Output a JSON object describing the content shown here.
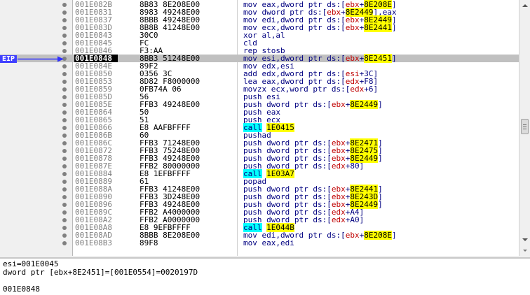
{
  "eip_label": "EIP",
  "rows": [
    {
      "addr": "001E082B",
      "hex": "8B83 8E208E00",
      "ins": [
        {
          "t": "mov eax,dword ptr ds:["
        },
        {
          "t": "ebx",
          "c": "red"
        },
        {
          "t": "+"
        },
        {
          "t": "8E208E",
          "h": "Y"
        },
        {
          "t": "]"
        }
      ]
    },
    {
      "addr": "001E0831",
      "hex": "8983 49248E00",
      "ins": [
        {
          "t": "mov dword ptr ds:["
        },
        {
          "t": "ebx",
          "c": "red"
        },
        {
          "t": "+"
        },
        {
          "t": "8E2449",
          "h": "Y"
        },
        {
          "t": "],eax"
        }
      ]
    },
    {
      "addr": "001E0837",
      "hex": "8BBB 49248E00",
      "ins": [
        {
          "t": "mov edi,dword ptr ds:["
        },
        {
          "t": "ebx",
          "c": "red"
        },
        {
          "t": "+"
        },
        {
          "t": "8E2449",
          "h": "Y"
        },
        {
          "t": "]"
        }
      ]
    },
    {
      "addr": "001E083D",
      "hex": "8B8B 41248E00",
      "ins": [
        {
          "t": "mov ecx,dword ptr ds:["
        },
        {
          "t": "ebx",
          "c": "red"
        },
        {
          "t": "+"
        },
        {
          "t": "8E2441",
          "h": "Y"
        },
        {
          "t": "]"
        }
      ]
    },
    {
      "addr": "001E0843",
      "hex": "30C0",
      "ins": [
        {
          "t": "xor al,al"
        }
      ]
    },
    {
      "addr": "001E0845",
      "hex": "FC",
      "ins": [
        {
          "t": "cld"
        }
      ]
    },
    {
      "addr": "001E0846",
      "hex": "F3:AA",
      "ins": [
        {
          "t": "rep stosb"
        }
      ]
    },
    {
      "addr": "001E0848",
      "hex": "8BB3 51248E00",
      "cur": true,
      "ins": [
        {
          "t": "mov esi,dword ptr ds:["
        },
        {
          "t": "ebx",
          "c": "red"
        },
        {
          "t": "+"
        },
        {
          "t": "8E2451",
          "h": "Y"
        },
        {
          "t": "]"
        }
      ]
    },
    {
      "addr": "001E084E",
      "hex": "89F2",
      "ins": [
        {
          "t": "mov edx,esi"
        }
      ]
    },
    {
      "addr": "001E0850",
      "hex": "0356 3C",
      "ins": [
        {
          "t": "add edx,dword ptr ds:["
        },
        {
          "t": "esi",
          "c": "red"
        },
        {
          "t": "+3C]"
        }
      ]
    },
    {
      "addr": "001E0853",
      "hex": "8D82 F8000000",
      "ins": [
        {
          "t": "lea eax,dword ptr ds:["
        },
        {
          "t": "edx",
          "c": "red"
        },
        {
          "t": "+F8]"
        }
      ]
    },
    {
      "addr": "001E0859",
      "hex": "0FB74A 06",
      "ins": [
        {
          "t": "movzx ecx,word ptr ds:["
        },
        {
          "t": "edx",
          "c": "red"
        },
        {
          "t": "+6]"
        }
      ]
    },
    {
      "addr": "001E085D",
      "hex": "56",
      "ins": [
        {
          "t": "push esi"
        }
      ]
    },
    {
      "addr": "001E085E",
      "hex": "FFB3 49248E00",
      "ins": [
        {
          "t": "push dword ptr ds:["
        },
        {
          "t": "ebx",
          "c": "red"
        },
        {
          "t": "+"
        },
        {
          "t": "8E2449",
          "h": "Y"
        },
        {
          "t": "]"
        }
      ]
    },
    {
      "addr": "001E0864",
      "hex": "50",
      "ins": [
        {
          "t": "push eax"
        }
      ]
    },
    {
      "addr": "001E0865",
      "hex": "51",
      "ins": [
        {
          "t": "push ecx"
        }
      ]
    },
    {
      "addr": "001E0866",
      "hex": "E8 AAFBFFFF",
      "ins": [
        {
          "t": "call",
          "h": "C"
        },
        {
          "t": " "
        },
        {
          "t": "1E0415",
          "h": "Y"
        }
      ]
    },
    {
      "addr": "001E086B",
      "hex": "60",
      "ins": [
        {
          "t": "pushad"
        }
      ]
    },
    {
      "addr": "001E086C",
      "hex": "FFB3 71248E00",
      "ins": [
        {
          "t": "push dword ptr ds:["
        },
        {
          "t": "ebx",
          "c": "red"
        },
        {
          "t": "+"
        },
        {
          "t": "8E2471",
          "h": "Y"
        },
        {
          "t": "]"
        }
      ]
    },
    {
      "addr": "001E0872",
      "hex": "FFB3 75248E00",
      "ins": [
        {
          "t": "push dword ptr ds:["
        },
        {
          "t": "ebx",
          "c": "red"
        },
        {
          "t": "+"
        },
        {
          "t": "8E2475",
          "h": "Y"
        },
        {
          "t": "]"
        }
      ]
    },
    {
      "addr": "001E0878",
      "hex": "FFB3 49248E00",
      "ins": [
        {
          "t": "push dword ptr ds:["
        },
        {
          "t": "ebx",
          "c": "red"
        },
        {
          "t": "+"
        },
        {
          "t": "8E2449",
          "h": "Y"
        },
        {
          "t": "]"
        }
      ]
    },
    {
      "addr": "001E087E",
      "hex": "FFB2 80000000",
      "ins": [
        {
          "t": "push dword ptr ds:["
        },
        {
          "t": "edx",
          "c": "red"
        },
        {
          "t": "+80]"
        }
      ]
    },
    {
      "addr": "001E0884",
      "hex": "E8 1EFBFFFF",
      "ins": [
        {
          "t": "call",
          "h": "C"
        },
        {
          "t": " "
        },
        {
          "t": "1E03A7",
          "h": "Y"
        }
      ]
    },
    {
      "addr": "001E0889",
      "hex": "61",
      "ins": [
        {
          "t": "popad"
        }
      ]
    },
    {
      "addr": "001E088A",
      "hex": "FFB3 41248E00",
      "ins": [
        {
          "t": "push dword ptr ds:["
        },
        {
          "t": "ebx",
          "c": "red"
        },
        {
          "t": "+"
        },
        {
          "t": "8E2441",
          "h": "Y"
        },
        {
          "t": "]"
        }
      ]
    },
    {
      "addr": "001E0890",
      "hex": "FFB3 3D248E00",
      "ins": [
        {
          "t": "push dword ptr ds:["
        },
        {
          "t": "ebx",
          "c": "red"
        },
        {
          "t": "+"
        },
        {
          "t": "8E243D",
          "h": "Y"
        },
        {
          "t": "]"
        }
      ]
    },
    {
      "addr": "001E0896",
      "hex": "FFB3 49248E00",
      "ins": [
        {
          "t": "push dword ptr ds:["
        },
        {
          "t": "ebx",
          "c": "red"
        },
        {
          "t": "+"
        },
        {
          "t": "8E2449",
          "h": "Y"
        },
        {
          "t": "]"
        }
      ]
    },
    {
      "addr": "001E089C",
      "hex": "FFB2 A4000000",
      "ins": [
        {
          "t": "push dword ptr ds:["
        },
        {
          "t": "edx",
          "c": "red"
        },
        {
          "t": "+A4]"
        }
      ]
    },
    {
      "addr": "001E08A2",
      "hex": "FFB2 A0000000",
      "ins": [
        {
          "t": "push dword ptr ds:["
        },
        {
          "t": "edx",
          "c": "red"
        },
        {
          "t": "+A0]"
        }
      ]
    },
    {
      "addr": "001E08A8",
      "hex": "E8 9EFBFFFF",
      "ins": [
        {
          "t": "call",
          "h": "C"
        },
        {
          "t": " "
        },
        {
          "t": "1E044B",
          "h": "Y"
        }
      ]
    },
    {
      "addr": "001E08AD",
      "hex": "8BBB 8E208E00",
      "ins": [
        {
          "t": "mov edi,dword ptr ds:["
        },
        {
          "t": "ebx",
          "c": "red"
        },
        {
          "t": "+"
        },
        {
          "t": "8E208E",
          "h": "Y"
        },
        {
          "t": "]"
        }
      ]
    },
    {
      "addr": "001E08B3",
      "hex": "89F8",
      "ins": [
        {
          "t": "mov eax,edi"
        }
      ]
    }
  ],
  "info": {
    "line1": "esi=001E0045",
    "line2": "dword ptr [ebx+8E2451]=[001E0554]=0020197D",
    "line3": "",
    "line4": "001E0848"
  }
}
